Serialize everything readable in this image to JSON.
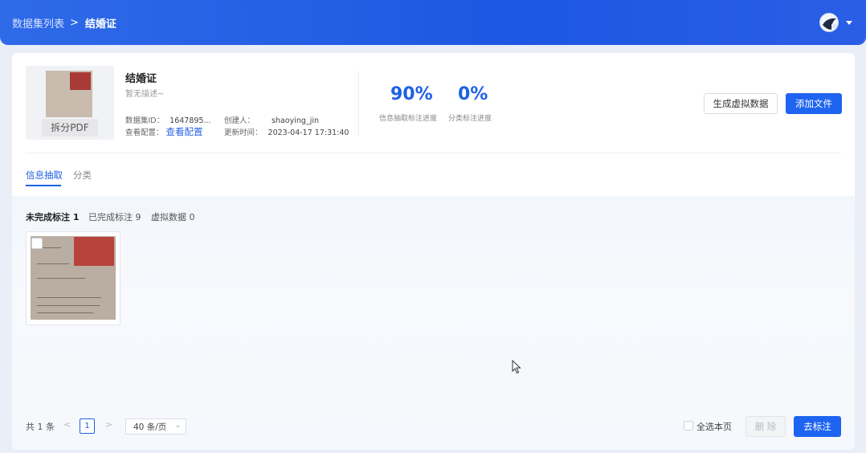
{
  "header": {
    "breadcrumb_parent": "数据集列表",
    "breadcrumb_sep": ">",
    "breadcrumb_current": "结婚证",
    "avatar_icon": "user-avatar-icon"
  },
  "dataset": {
    "thumbnail_label": "拆分PDF",
    "title": "结婚证",
    "description": "暂无描述~",
    "id_label": "数据集ID：",
    "id_value": "1647895...",
    "config_label": "查看配置：",
    "config_link": "查看配置",
    "creator_label": "创建人：",
    "creator_value": "shaoying_jin",
    "updated_label": "更新时间：",
    "updated_value": "2023-04-17 17:31:40"
  },
  "stats": {
    "extract_value": "90%",
    "extract_label": "信息抽取标注进度",
    "classify_value": "0%",
    "classify_label": "分类标注进度"
  },
  "actions": {
    "generate_label": "生成虚拟数据",
    "add_file_label": "添加文件"
  },
  "tabs": [
    {
      "label": "信息抽取",
      "active": true
    },
    {
      "label": "分类",
      "active": false
    }
  ],
  "filters": [
    {
      "label": "未完成标注 1",
      "active": true
    },
    {
      "label": "已完成标注 9",
      "active": false
    },
    {
      "label": "虚拟数据 0",
      "active": false
    }
  ],
  "pagination": {
    "total": "共 1 条",
    "prev": "<",
    "page": "1",
    "next": ">",
    "page_size": "40 条/页"
  },
  "footer": {
    "select_all_label": "全选本页",
    "delete_label": "删 除",
    "annotate_label": "去标注"
  },
  "colors": {
    "primary": "#1e64f0",
    "header": "#2f6ae8"
  }
}
